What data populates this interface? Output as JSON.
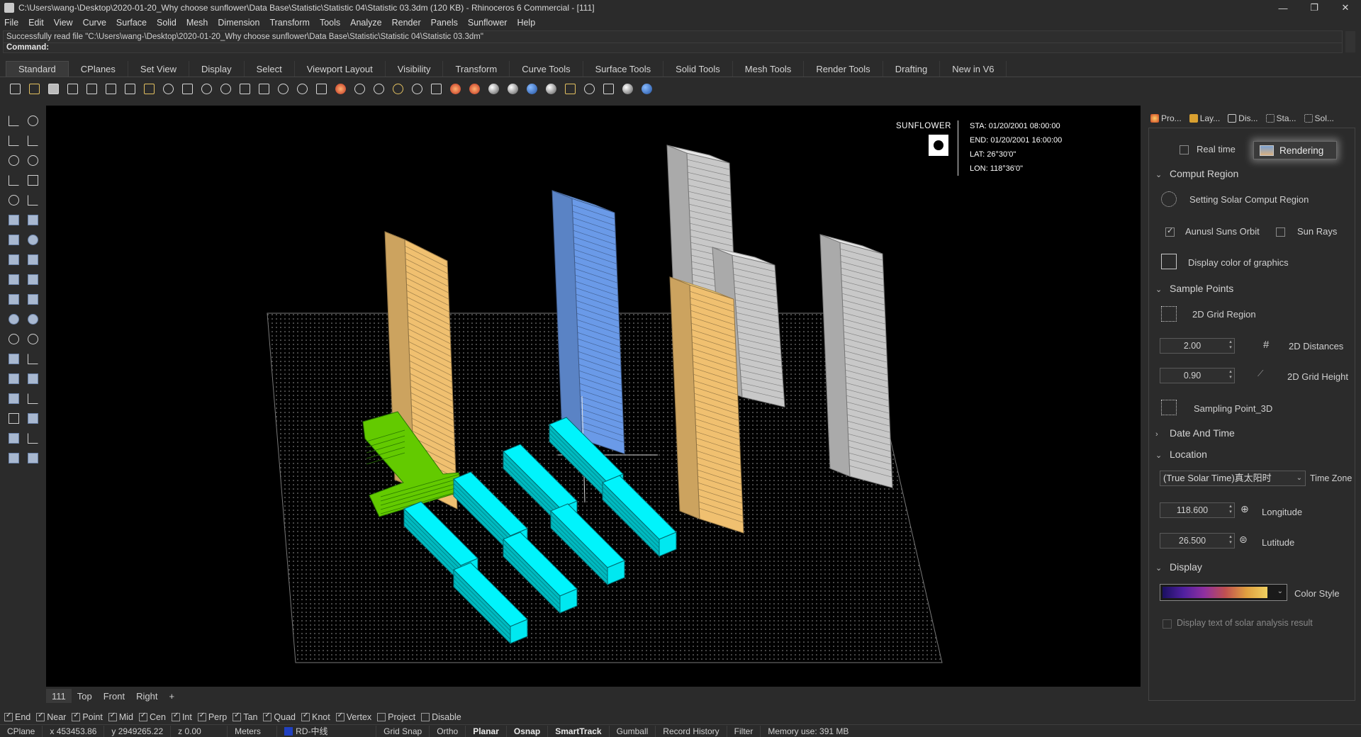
{
  "window": {
    "title": "C:\\Users\\wang-\\Desktop\\2020-01-20_Why choose sunflower\\Data Base\\Statistic\\Statistic 04\\Statistic 03.3dm (120 KB) - Rhinoceros 6 Commercial - [111]",
    "minimize": "—",
    "maximize": "❐",
    "close": "✕"
  },
  "menu": [
    "File",
    "Edit",
    "View",
    "Curve",
    "Surface",
    "Solid",
    "Mesh",
    "Dimension",
    "Transform",
    "Tools",
    "Analyze",
    "Render",
    "Panels",
    "Sunflower",
    "Help"
  ],
  "command": {
    "message": "Successfully read file \"C:\\Users\\wang-\\Desktop\\2020-01-20_Why choose sunflower\\Data Base\\Statistic\\Statistic 04\\Statistic 03.3dm\"",
    "prompt": "Command:"
  },
  "tabs": [
    "Standard",
    "CPlanes",
    "Set View",
    "Display",
    "Select",
    "Viewport Layout",
    "Visibility",
    "Transform",
    "Curve Tools",
    "Surface Tools",
    "Solid Tools",
    "Mesh Tools",
    "Render Tools",
    "Drafting",
    "New in V6"
  ],
  "active_tab": "Standard",
  "viewport": {
    "brand": "SUNFLOWER",
    "sta": "STA: 01/20/2001 08:00:00",
    "end": "END: 01/20/2001 16:00:00",
    "lat": "LAT: 26°30'0\"",
    "lon": "LON: 118°36'0\"",
    "colors": {
      "orange": "#f0c070",
      "blue": "#6a9ae8",
      "gray": "#c8c8c8",
      "green": "#6ee000",
      "cyan": "#00e8f0"
    }
  },
  "viewport_tabs": [
    "111",
    "Top",
    "Front",
    "Right",
    "+"
  ],
  "panel": {
    "tabs": [
      {
        "label": "Pro...",
        "icon": "properties-icon"
      },
      {
        "label": "Lay...",
        "icon": "layers-icon"
      },
      {
        "label": "Dis...",
        "icon": "display-icon"
      },
      {
        "label": "Sta...",
        "icon": "statistics-icon"
      },
      {
        "label": "Sol...",
        "icon": "solar-icon"
      }
    ],
    "real_time": "Real time",
    "rendering": "Rendering",
    "comput_region": "Comput Region",
    "setting_region": "Setting Solar Comput Region",
    "annual_orbit": "Aunusl Suns Orbit",
    "sun_rays": "Sun Rays",
    "display_color": "Display color of graphics",
    "sample_points": "Sample Points",
    "grid_region": "2D Grid Region",
    "distances_value": "2.00",
    "distances_label": "2D Distances",
    "height_value": "0.90",
    "height_label": "2D Grid Height",
    "sampling_3d": "Sampling Point_3D",
    "date_time": "Date And Time",
    "location": "Location",
    "timezone_value": "(True Solar Time)真太阳时",
    "timezone_label": "Time Zone",
    "longitude_value": "118.600",
    "longitude_label": "Longitude",
    "latitude_value": "26.500",
    "latitude_label": "Lutitude",
    "display": "Display",
    "color_style": "Color Style",
    "display_text": "Display text of solar analysis result"
  },
  "osnaps": [
    {
      "label": "End",
      "on": true
    },
    {
      "label": "Near",
      "on": true
    },
    {
      "label": "Point",
      "on": true
    },
    {
      "label": "Mid",
      "on": true
    },
    {
      "label": "Cen",
      "on": true
    },
    {
      "label": "Int",
      "on": true
    },
    {
      "label": "Perp",
      "on": true
    },
    {
      "label": "Tan",
      "on": true
    },
    {
      "label": "Quad",
      "on": true
    },
    {
      "label": "Knot",
      "on": true
    },
    {
      "label": "Vertex",
      "on": true
    },
    {
      "label": "Project",
      "on": false
    },
    {
      "label": "Disable",
      "on": false
    }
  ],
  "status": {
    "cplane": "CPlane",
    "x": "x 453453.86",
    "y": "y 2949265.22",
    "z": "z 0.00",
    "units": "Meters",
    "layer": "RD-中线",
    "grid_snap": "Grid Snap",
    "ortho": "Ortho",
    "planar": "Planar",
    "osnap": "Osnap",
    "smarttrack": "SmartTrack",
    "gumball": "Gumball",
    "record_history": "Record History",
    "filter": "Filter",
    "memory": "Memory use: 391 MB"
  }
}
